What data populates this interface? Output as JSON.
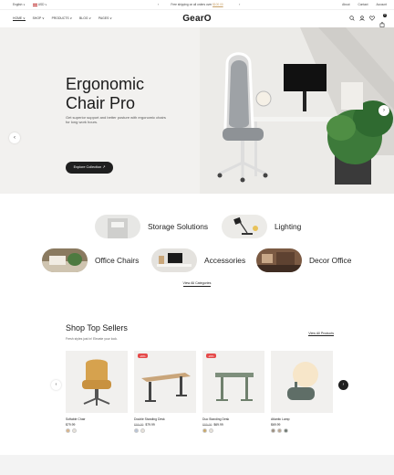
{
  "topbar": {
    "language": "English ∨",
    "currency": "USD ∨",
    "promo_prefix": "Free shipping on all orders over",
    "promo_link": "$100.00",
    "util": [
      "About",
      "Contact",
      "Account"
    ]
  },
  "header": {
    "logo": "GearO",
    "nav": [
      "HOME ∨",
      "SHOP ∨",
      "PRODUCTS ∨",
      "BLOG ∨",
      "PAGES ∨"
    ],
    "cart_count": "0"
  },
  "hero": {
    "title_line1": "Ergonomic",
    "title_line2": "Chair Pro",
    "description": "Get superior support and better posture with ergonomic chairs for long work hours.",
    "cta": "Explore Collection ↗"
  },
  "categories": [
    {
      "label": "Storage Solutions"
    },
    {
      "label": "Lighting"
    },
    {
      "label": "Office Chairs"
    },
    {
      "label": "Accessories"
    },
    {
      "label": "Decor Office"
    }
  ],
  "categories_link": "View All Categories",
  "sellers": {
    "title": "Shop Top Sellers",
    "subtitle": "Fresh styles just in! Elevate your look.",
    "view_all": "View All Products",
    "products": [
      {
        "name": "Softable Chair",
        "price": "$79.99",
        "old_price": "",
        "badge": "",
        "swatches": [
          "#d9b58a",
          "#e7e2da"
        ]
      },
      {
        "name": "Double Standing Desk",
        "price": "$79.99",
        "old_price": "$99.99",
        "badge": "-20%",
        "swatches": [
          "#b9c4d6",
          "#e7e2da"
        ]
      },
      {
        "name": "Duo Standing Desk",
        "price": "$69.99",
        "old_price": "$89.99",
        "badge": "-20%",
        "swatches": [
          "#c8a86a",
          "#e7e2da"
        ]
      },
      {
        "name": "Atlantic Lamp",
        "price": "$69.99",
        "old_price": "",
        "badge": "",
        "swatches": [
          "#9c8f80",
          "#b9a58e",
          "#6f7a72"
        ]
      }
    ]
  },
  "colors": {
    "accent": "#c8a26a",
    "sale_badge": "#e54a4a",
    "dark": "#1f1f1f"
  }
}
